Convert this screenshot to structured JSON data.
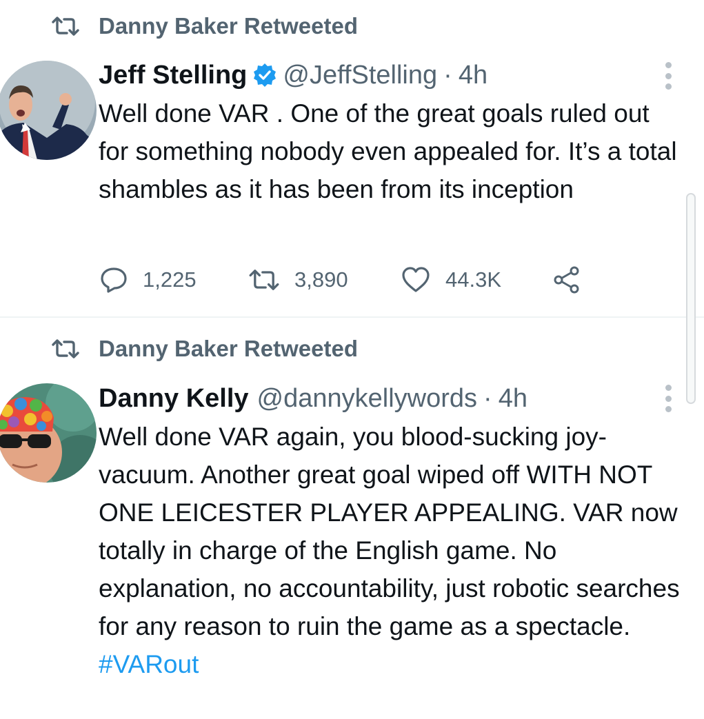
{
  "tweets": [
    {
      "retweeted_by": "Danny Baker Retweeted",
      "author_name": "Jeff Stelling",
      "handle": "@JeffStelling",
      "separator": "·",
      "time": "4h",
      "verified": true,
      "text": "Well done VAR . One of the great goals ruled out for something  nobody even appealed for. It’s a total shambles as it has been from its inception",
      "replies": "1,225",
      "retweets": "3,890",
      "likes": "44.3K"
    },
    {
      "retweeted_by": "Danny Baker Retweeted",
      "author_name": "Danny Kelly",
      "handle": "@dannykellywords",
      "separator": "·",
      "time": "4h",
      "verified": false,
      "text": "Well done VAR again, you blood-sucking joy-vacuum. Another great goal wiped off WITH NOT ONE LEICESTER PLAYER APPEALING. VAR now totally in charge of the English game. No explanation, no accountability, just robotic searches for any reason to ruin the game as a spectacle.",
      "hashtag": "#VARout"
    }
  ],
  "colors": {
    "text": "#0f1419",
    "muted": "#536471",
    "accent": "#1d9bf0",
    "divider": "#eff3f4"
  },
  "icons": [
    "retweet-icon",
    "verified-badge-icon",
    "more-options-icon",
    "reply-icon",
    "like-icon",
    "share-icon"
  ]
}
